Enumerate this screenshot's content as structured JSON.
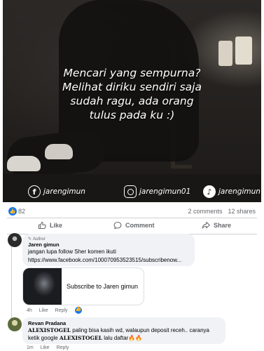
{
  "post_image": {
    "caption_lines": [
      "Mencari yang sempurna?",
      "Melihat diriku sendiri saja",
      "sudah ragu, ada orang",
      "tulus pada ku :)"
    ],
    "socials": {
      "facebook": "jarengimun",
      "instagram": "jarengimun01",
      "tiktok": "jarengimun"
    }
  },
  "stats": {
    "reactions": "82",
    "comments": "2 comments",
    "shares": "12 shares"
  },
  "actions": {
    "like": "Like",
    "comment": "Comment",
    "share": "Share"
  },
  "comments": [
    {
      "tag": "Author",
      "name": "Jaren gimun",
      "text": "jangan lupa follow Sher komen ikuti",
      "link": "https://www.facebook.com/100070953523515/subscribenow...",
      "card_title": "Subscribe to Jaren gimun",
      "time": "4h",
      "like": "Like",
      "reply": "Reply"
    },
    {
      "name": "Revan Pradana",
      "text_bold1": "ALEXISTOGEL",
      "text_part1": " paling bisa kasih wd, walaupun deposit receh.. caranya ketik google ",
      "text_bold2": "ALEXISTOGEL",
      "text_part2": " lalu daftar🔥🔥",
      "time": "1m",
      "like": "Like",
      "reply": "Reply"
    }
  ],
  "colors": {
    "accent": "#1877f2",
    "bubble": "#f0f2f5",
    "muted": "#65676b"
  }
}
